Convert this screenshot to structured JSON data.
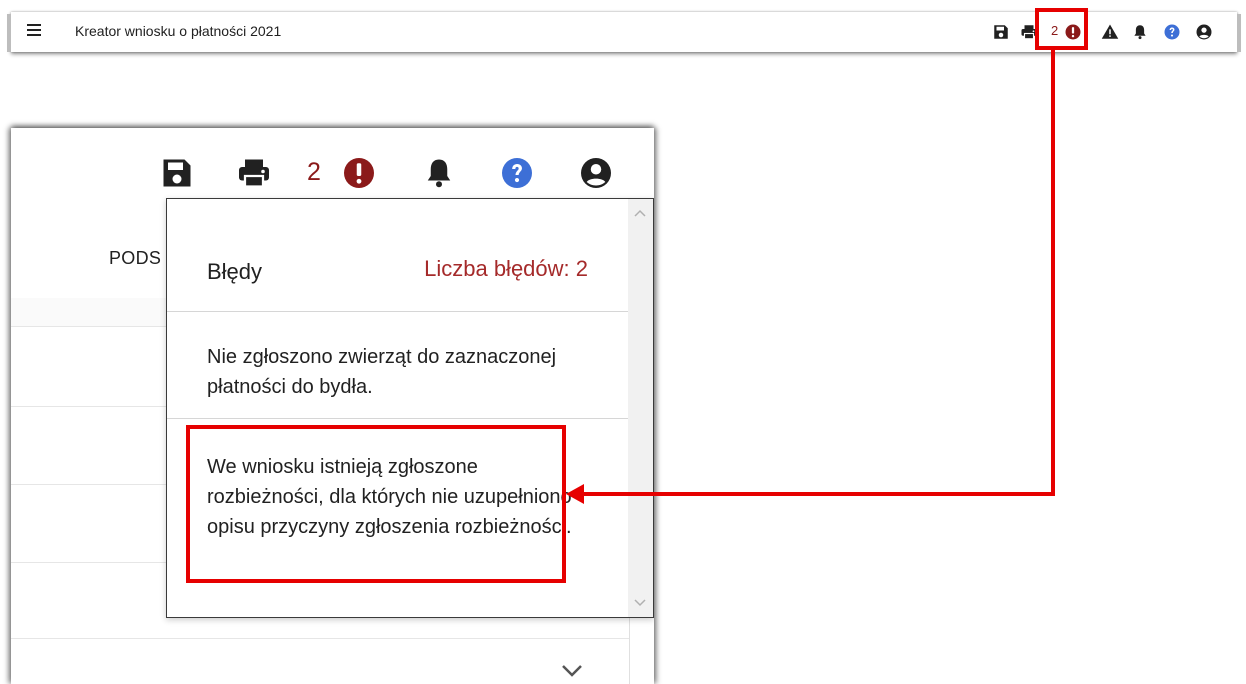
{
  "toolbar": {
    "title": "Kreator wniosku o płatności 2021",
    "error_count": "2",
    "icons": [
      "menu-icon",
      "save-icon",
      "print-icon",
      "error-icon",
      "warning-icon",
      "bell-icon",
      "help-icon",
      "account-icon"
    ]
  },
  "zoom": {
    "error_count": "2",
    "partial_tab_label": "PODS"
  },
  "errors_panel": {
    "title": "Błędy",
    "count_label": "Liczba błędów: 2",
    "items": [
      {
        "text": "Nie zgłoszono zwierząt do zaznaczonej płatności do bydła."
      },
      {
        "text": "We wniosku istnieją zgłoszone rozbieżności, dla których nie uzupełniono opisu przyczyny zgłoszenia rozbieżności."
      }
    ]
  },
  "colors": {
    "highlight": "#e60000",
    "error_red": "#8b1a1a",
    "help_blue": "#3d6fd6",
    "icon_dark": "#212121"
  }
}
